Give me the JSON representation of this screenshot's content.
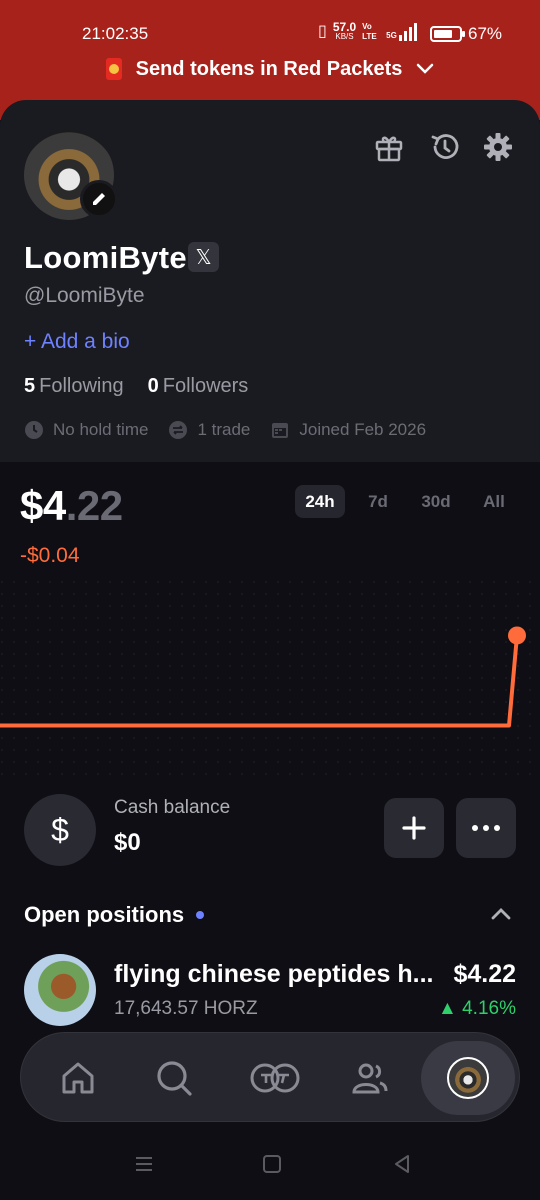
{
  "status_bar": {
    "time": "21:02:35",
    "net_speed": "57.0",
    "net_unit": "KB/S",
    "volte": "Vo LTE",
    "network": "5G",
    "battery": "67%"
  },
  "banner": {
    "text": "Send tokens in Red Packets"
  },
  "profile": {
    "name": "LoomiByte",
    "x_badge": "𝕏",
    "handle": "@LoomiByte",
    "add_bio": "+ Add a bio",
    "following_count": "5",
    "following_label": "Following",
    "followers_count": "0",
    "followers_label": "Followers",
    "hold_time": "No hold time",
    "trades": "1 trade",
    "joined": "Joined Feb 2026"
  },
  "portfolio": {
    "value_main": "$4",
    "value_decimal": ".22",
    "change": "-$0.04",
    "ranges": [
      "24h",
      "7d",
      "30d",
      "All"
    ],
    "active_range": "24h"
  },
  "chart_data": {
    "type": "line",
    "series": [
      {
        "values": [
          0.2,
          0.2,
          0.2,
          0.2,
          0.2,
          0.2,
          0.2,
          0.2,
          0.2,
          0.2,
          0.2,
          4.22
        ]
      }
    ],
    "ylim": [
      0,
      5
    ],
    "color": "#ff6b3a",
    "grid": false
  },
  "cash": {
    "label": "Cash balance",
    "value": "$0",
    "symbol": "$"
  },
  "positions": {
    "title": "Open positions",
    "items": [
      {
        "name": "flying chinese peptides h...",
        "quantity": "17,643.57 HORZ",
        "value": "$4.22",
        "change": "▲ 4.16%"
      }
    ]
  },
  "nav": {
    "items": [
      "home-icon",
      "search-icon",
      "trade-icon",
      "community-icon",
      "profile-avatar"
    ]
  },
  "colors": {
    "accent": "#6e82ff",
    "negative": "#ff6b3a",
    "positive": "#2fd06b",
    "banner": "#a8221c"
  }
}
